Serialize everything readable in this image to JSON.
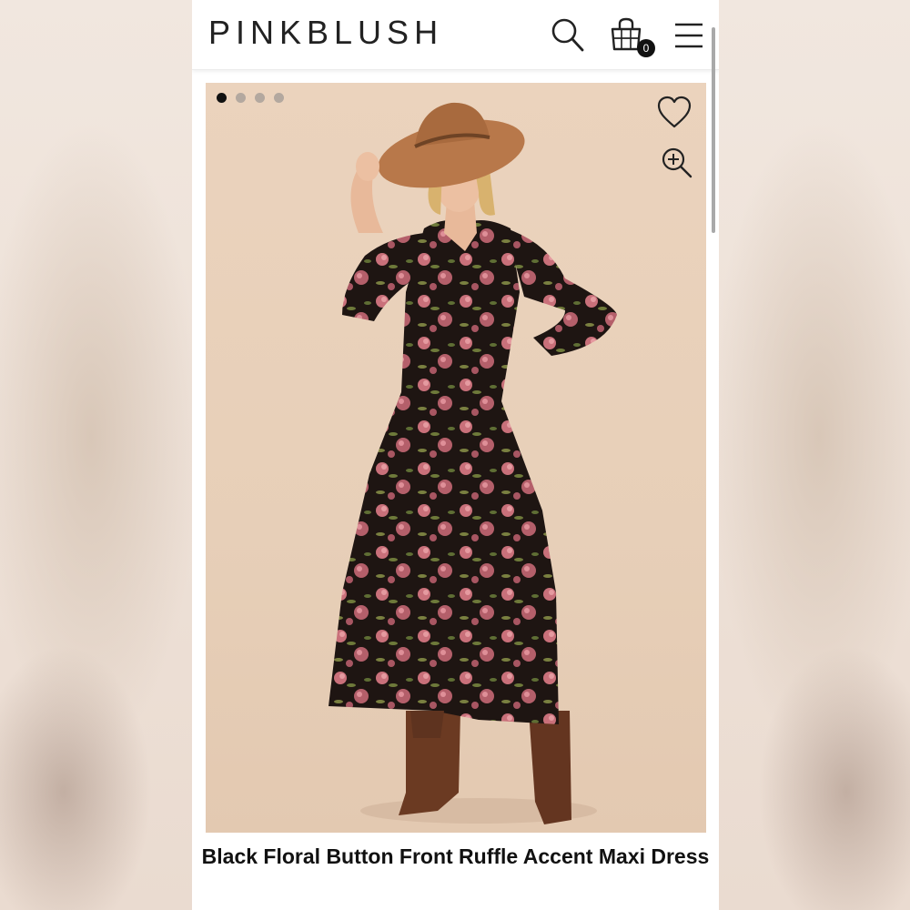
{
  "header": {
    "logo": "PINKBLUSH",
    "cart_count": "0",
    "icons": [
      "search-icon",
      "shopping-bag-icon",
      "hamburger-menu-icon"
    ]
  },
  "gallery": {
    "image_count": 4,
    "active_index": 0,
    "icons": [
      "heart-icon",
      "zoom-in-icon"
    ]
  },
  "product": {
    "title": "Black Floral Button Front Ruffle Accent Maxi Dress"
  },
  "colors": {
    "photo_background": "#e9d1bb",
    "hat": "#b8784a",
    "dress": "#1e1512",
    "flowers": "#c9707a",
    "boots": "#6b3a22"
  }
}
